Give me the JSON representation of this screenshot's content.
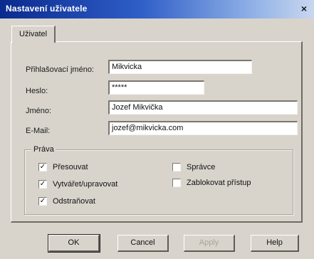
{
  "window": {
    "title": "Nastavení uživatele",
    "close_glyph": "×"
  },
  "tabs": [
    {
      "label": "Uživatel"
    }
  ],
  "form": {
    "login_label": "Přihlašovací jméno:",
    "login_value": "Mikvicka",
    "password_label": "Heslo:",
    "password_value": "*****",
    "name_label": "Jméno:",
    "name_value": "Jozef Mikvička",
    "email_label": "E-Mail:",
    "email_value": "jozef@mikvicka.com"
  },
  "rights": {
    "title": "Práva",
    "items": [
      {
        "label": "Přesouvat",
        "checked": true
      },
      {
        "label": "Vytvářet/upravovat",
        "checked": true
      },
      {
        "label": "Odstraňovat",
        "checked": true
      },
      {
        "label": "Správce",
        "checked": false
      },
      {
        "label": "Zablokovat přístup",
        "checked": false
      }
    ]
  },
  "buttons": {
    "ok": "OK",
    "cancel": "Cancel",
    "apply": "Apply",
    "help": "Help"
  },
  "colors": {
    "titlebar_start": "#0a2a8e",
    "titlebar_end": "#c9d7ef",
    "dialog_face": "#d8d4cc"
  }
}
